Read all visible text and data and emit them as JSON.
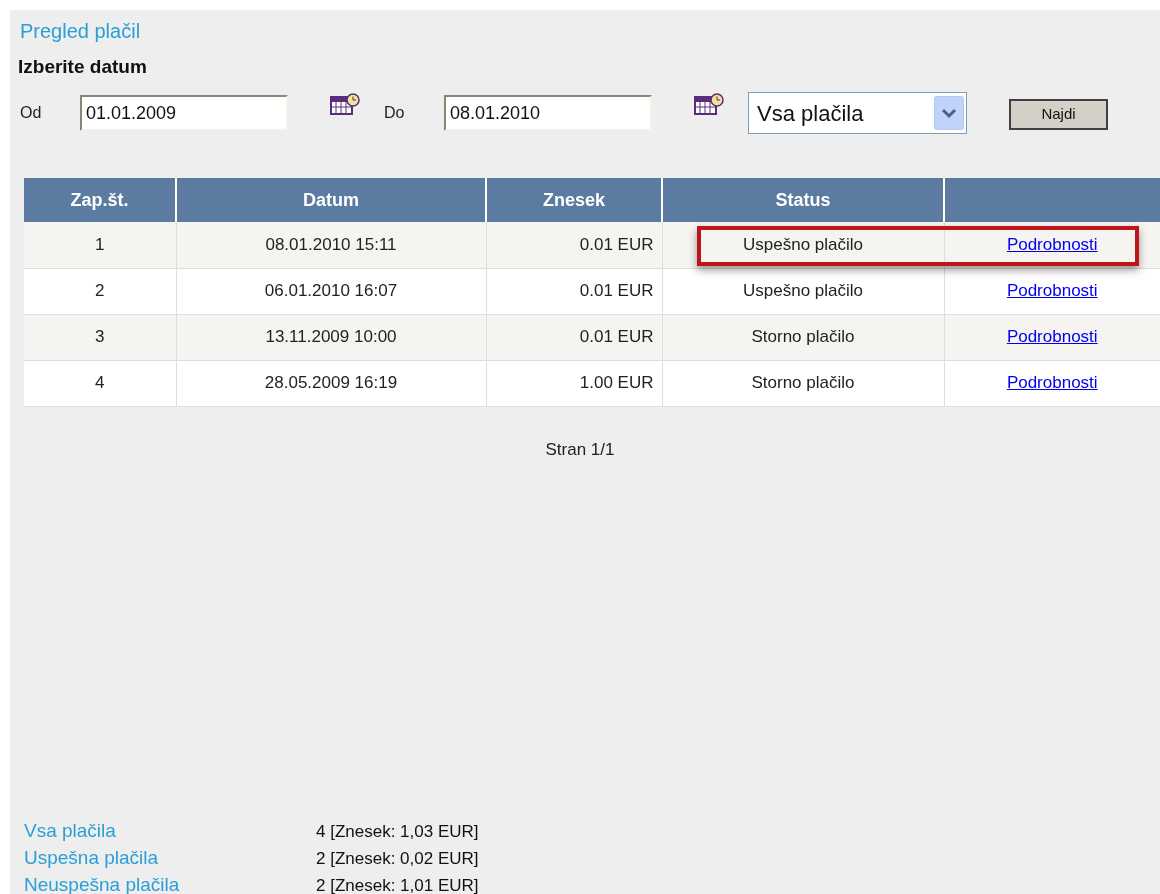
{
  "title": "Pregled plačil",
  "date_section": {
    "heading": "Izberite datum",
    "from_label": "Od",
    "from_value": "01.01.2009",
    "to_label": "Do",
    "to_value": "08.01.2010",
    "filter": "Vsa plačila",
    "search_button": "Najdi"
  },
  "table": {
    "columns": [
      "Zap.št.",
      "Datum",
      "Znesek",
      "Status"
    ],
    "rows": [
      {
        "number": "1",
        "date": "08.01.2010 15:11",
        "amount": "0.01 EUR",
        "status": "Uspešno plačilo",
        "link": "Podrobnosti",
        "highlighted": true
      },
      {
        "number": "2",
        "date": "06.01.2010 16:07",
        "amount": "0.01 EUR",
        "status": "Uspešno plačilo",
        "link": "Podrobnosti",
        "highlighted": false
      },
      {
        "number": "3",
        "date": "13.11.2009 10:00",
        "amount": "0.01 EUR",
        "status": "Storno plačilo",
        "link": "Podrobnosti",
        "highlighted": false
      },
      {
        "number": "4",
        "date": "28.05.2009 16:19",
        "amount": "1.00 EUR",
        "status": "Storno plačilo",
        "link": "Podrobnosti",
        "highlighted": false
      }
    ]
  },
  "pagination": "Stran 1/1",
  "summary": [
    {
      "label": "Vsa plačila",
      "value": "4 [Znesek: 1,03 EUR]"
    },
    {
      "label": "Uspešna plačila",
      "value": "2 [Znesek: 0,02 EUR]"
    },
    {
      "label": "Neuspešna plačila",
      "value": "2 [Znesek: 1,01 EUR]"
    }
  ]
}
